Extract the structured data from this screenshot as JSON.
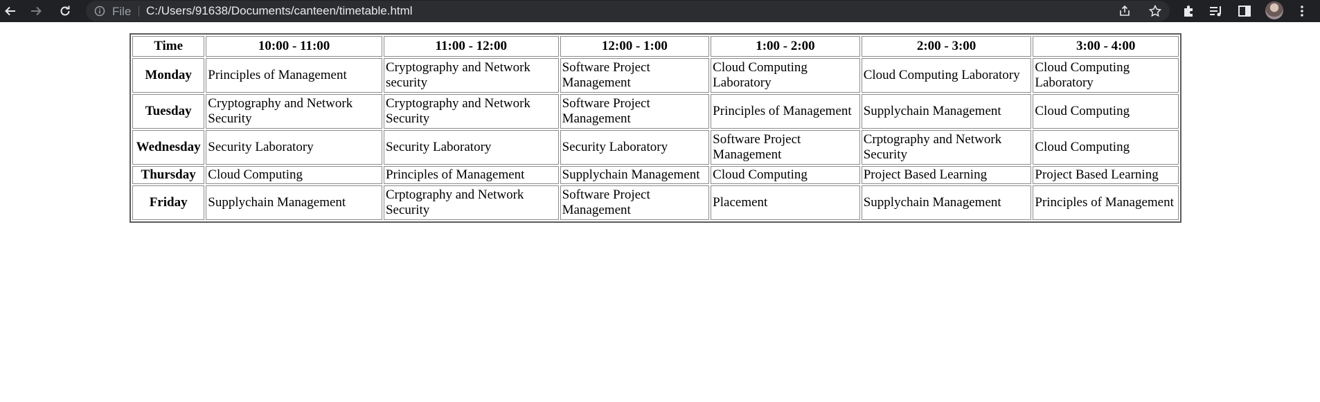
{
  "browser": {
    "scheme_label": "File",
    "url": "C:/Users/91638/Documents/canteen/timetable.html"
  },
  "timetable": {
    "header": [
      "Time",
      "10:00 - 11:00",
      "11:00 - 12:00",
      "12:00 - 1:00",
      "1:00 - 2:00",
      "2:00 - 3:00",
      "3:00 - 4:00"
    ],
    "rows": [
      {
        "day": "Monday",
        "cells": [
          "Principles of Management",
          "Cryptography and Network security",
          "Software Project Management",
          "Cloud Computing Laboratory",
          "Cloud Computing Laboratory",
          "Cloud Computing Laboratory"
        ]
      },
      {
        "day": "Tuesday",
        "cells": [
          "Cryptography and Network Security",
          "Cryptography and Network Security",
          "Software Project Management",
          "Principles of Management",
          "Supplychain Management",
          "Cloud Computing"
        ]
      },
      {
        "day": "Wednesday",
        "cells": [
          "Security Laboratory",
          "Security Laboratory",
          "Security Laboratory",
          "Software Project Management",
          "Crptography and Network Security",
          "Cloud Computing"
        ]
      },
      {
        "day": "Thursday",
        "cells": [
          "Cloud Computing",
          "Principles of Management",
          "Supplychain Management",
          "Cloud Computing",
          "Project Based Learning",
          "Project Based Learning"
        ]
      },
      {
        "day": "Friday",
        "cells": [
          "Supplychain Management",
          "Crptography and Network Security",
          "Software Project Management",
          "Placement",
          "Supplychain Management",
          "Principles of Management"
        ]
      }
    ]
  }
}
